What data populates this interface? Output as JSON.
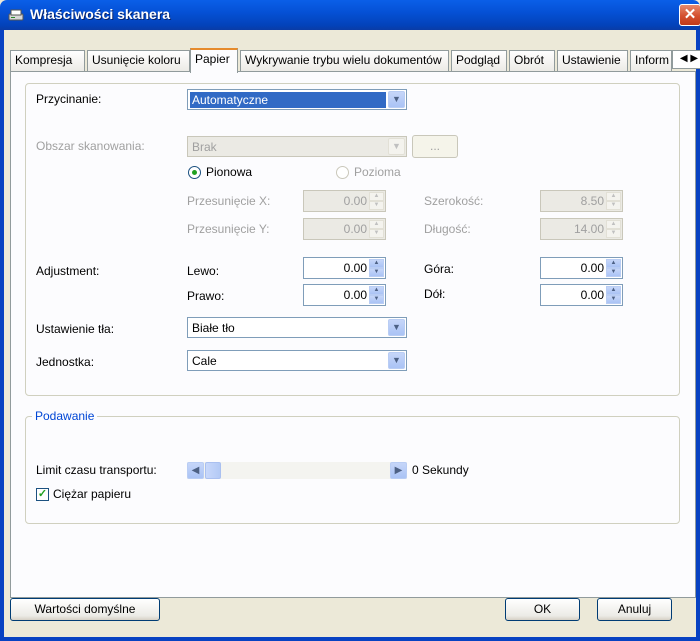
{
  "window": {
    "title": "Właściwości skanera",
    "close_glyph": "✕"
  },
  "tabs": [
    "Kompresja",
    "Usunięcie koloru",
    "Papier",
    "Wykrywanie trybu wielu dokumentów",
    "Podgląd",
    "Obrót",
    "Ustawienie",
    "Inform"
  ],
  "active_tab": "Papier",
  "tab_scroll": {
    "left": "◀",
    "right": "▶"
  },
  "paper": {
    "cropping_label": "Przycinanie:",
    "cropping_value": "Automatyczne",
    "scan_area_label": "Obszar skanowania:",
    "scan_area_value": "Brak",
    "scan_area_button": "...",
    "orientation_portrait": "Pionowa",
    "orientation_landscape": "Pozioma",
    "offset_x_label": "Przesunięcie X:",
    "offset_x_value": "0.00",
    "offset_y_label": "Przesunięcie Y:",
    "offset_y_value": "0.00",
    "width_label": "Szerokość:",
    "width_value": "8.50",
    "length_label": "Długość:",
    "length_value": "14.00",
    "adjustment_label": "Adjustment:",
    "left_label": "Lewo:",
    "left_value": "0.00",
    "right_label": "Prawo:",
    "right_value": "0.00",
    "top_label": "Góra:",
    "top_value": "0.00",
    "bottom_label": "Dół:",
    "bottom_value": "0.00",
    "background_label": "Ustawienie tła:",
    "background_value": "Białe tło",
    "unit_label": "Jednostka:",
    "unit_value": "Cale"
  },
  "feeding": {
    "legend": "Podawanie",
    "timeout_label": "Limit czasu transportu:",
    "timeout_value": "0 Sekundy",
    "paper_weight_label": "Ciężar papieru",
    "paper_weight_checked": true
  },
  "buttons": {
    "defaults": "Wartości domyślne",
    "ok": "OK",
    "cancel": "Anuluj"
  },
  "icons": {
    "combo_arrow": "▼",
    "spin_up": "▲",
    "spin_down": "▼",
    "checkmark": "✓",
    "left_arrow": "◀",
    "right_arrow": "▶"
  }
}
